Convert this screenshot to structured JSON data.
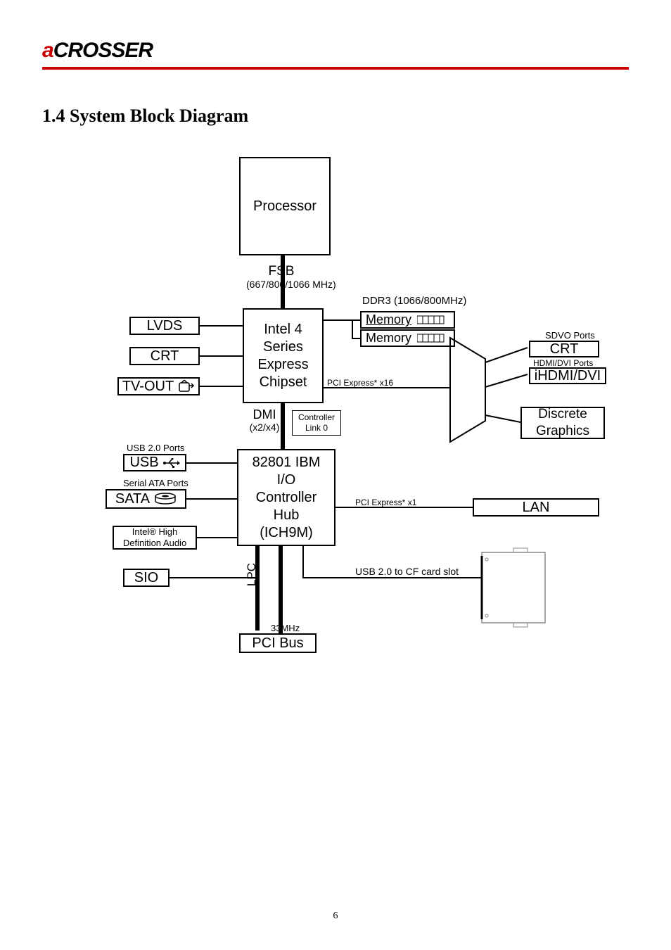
{
  "header": {
    "brand_a": "a",
    "brand_rest": "CROSSER"
  },
  "section_title": "1.4 System Block Diagram",
  "blocks": {
    "processor": "Processor",
    "fsb_label": "FSB",
    "fsb_speed": "(667/800/1066 MHz)",
    "ddr3_label": "DDR3 (1066/800MHz)",
    "memory1": "Memory",
    "memory2": "Memory",
    "lvds": "LVDS",
    "crt_left": "CRT",
    "tvout": "TV-OUT",
    "chipset_l1": "Intel 4",
    "chipset_l2": "Series",
    "chipset_l3": "Express",
    "chipset_l4": "Chipset",
    "pcie_x16": "PCI Express* x16",
    "sdvo_ports": "SDVO Ports",
    "crt_right": "CRT",
    "hdmi_dvi_ports": "HDMI/DVI Ports",
    "ihdmidvi": "iHDMI/DVI",
    "discrete_l1": "Discrete",
    "discrete_l2": "Graphics",
    "dmi_label": "DMI",
    "dmi_speed": "(x2/x4)",
    "ctrl_l1": "Controller",
    "ctrl_l2": "Link 0",
    "usb_ports": "USB 2.0 Ports",
    "usb": "USB",
    "sata_ports": "Serial ATA Ports",
    "sata": "SATA",
    "hdaudio_l1": "Intel® High",
    "hdaudio_l2": "Definition Audio",
    "ich_l1": "82801 IBM",
    "ich_l2": "I/O",
    "ich_l3": "Controller",
    "ich_l4": "Hub",
    "ich_l5": "(ICH9M)",
    "pcie_x1": "PCI Express* x1",
    "lan": "LAN",
    "usb_cf": "USB 2.0 to CF card slot",
    "sio": "SIO",
    "lpc": "LPC",
    "pci_33": "33MHz",
    "pcibus": "PCI Bus"
  },
  "footnote": "6"
}
